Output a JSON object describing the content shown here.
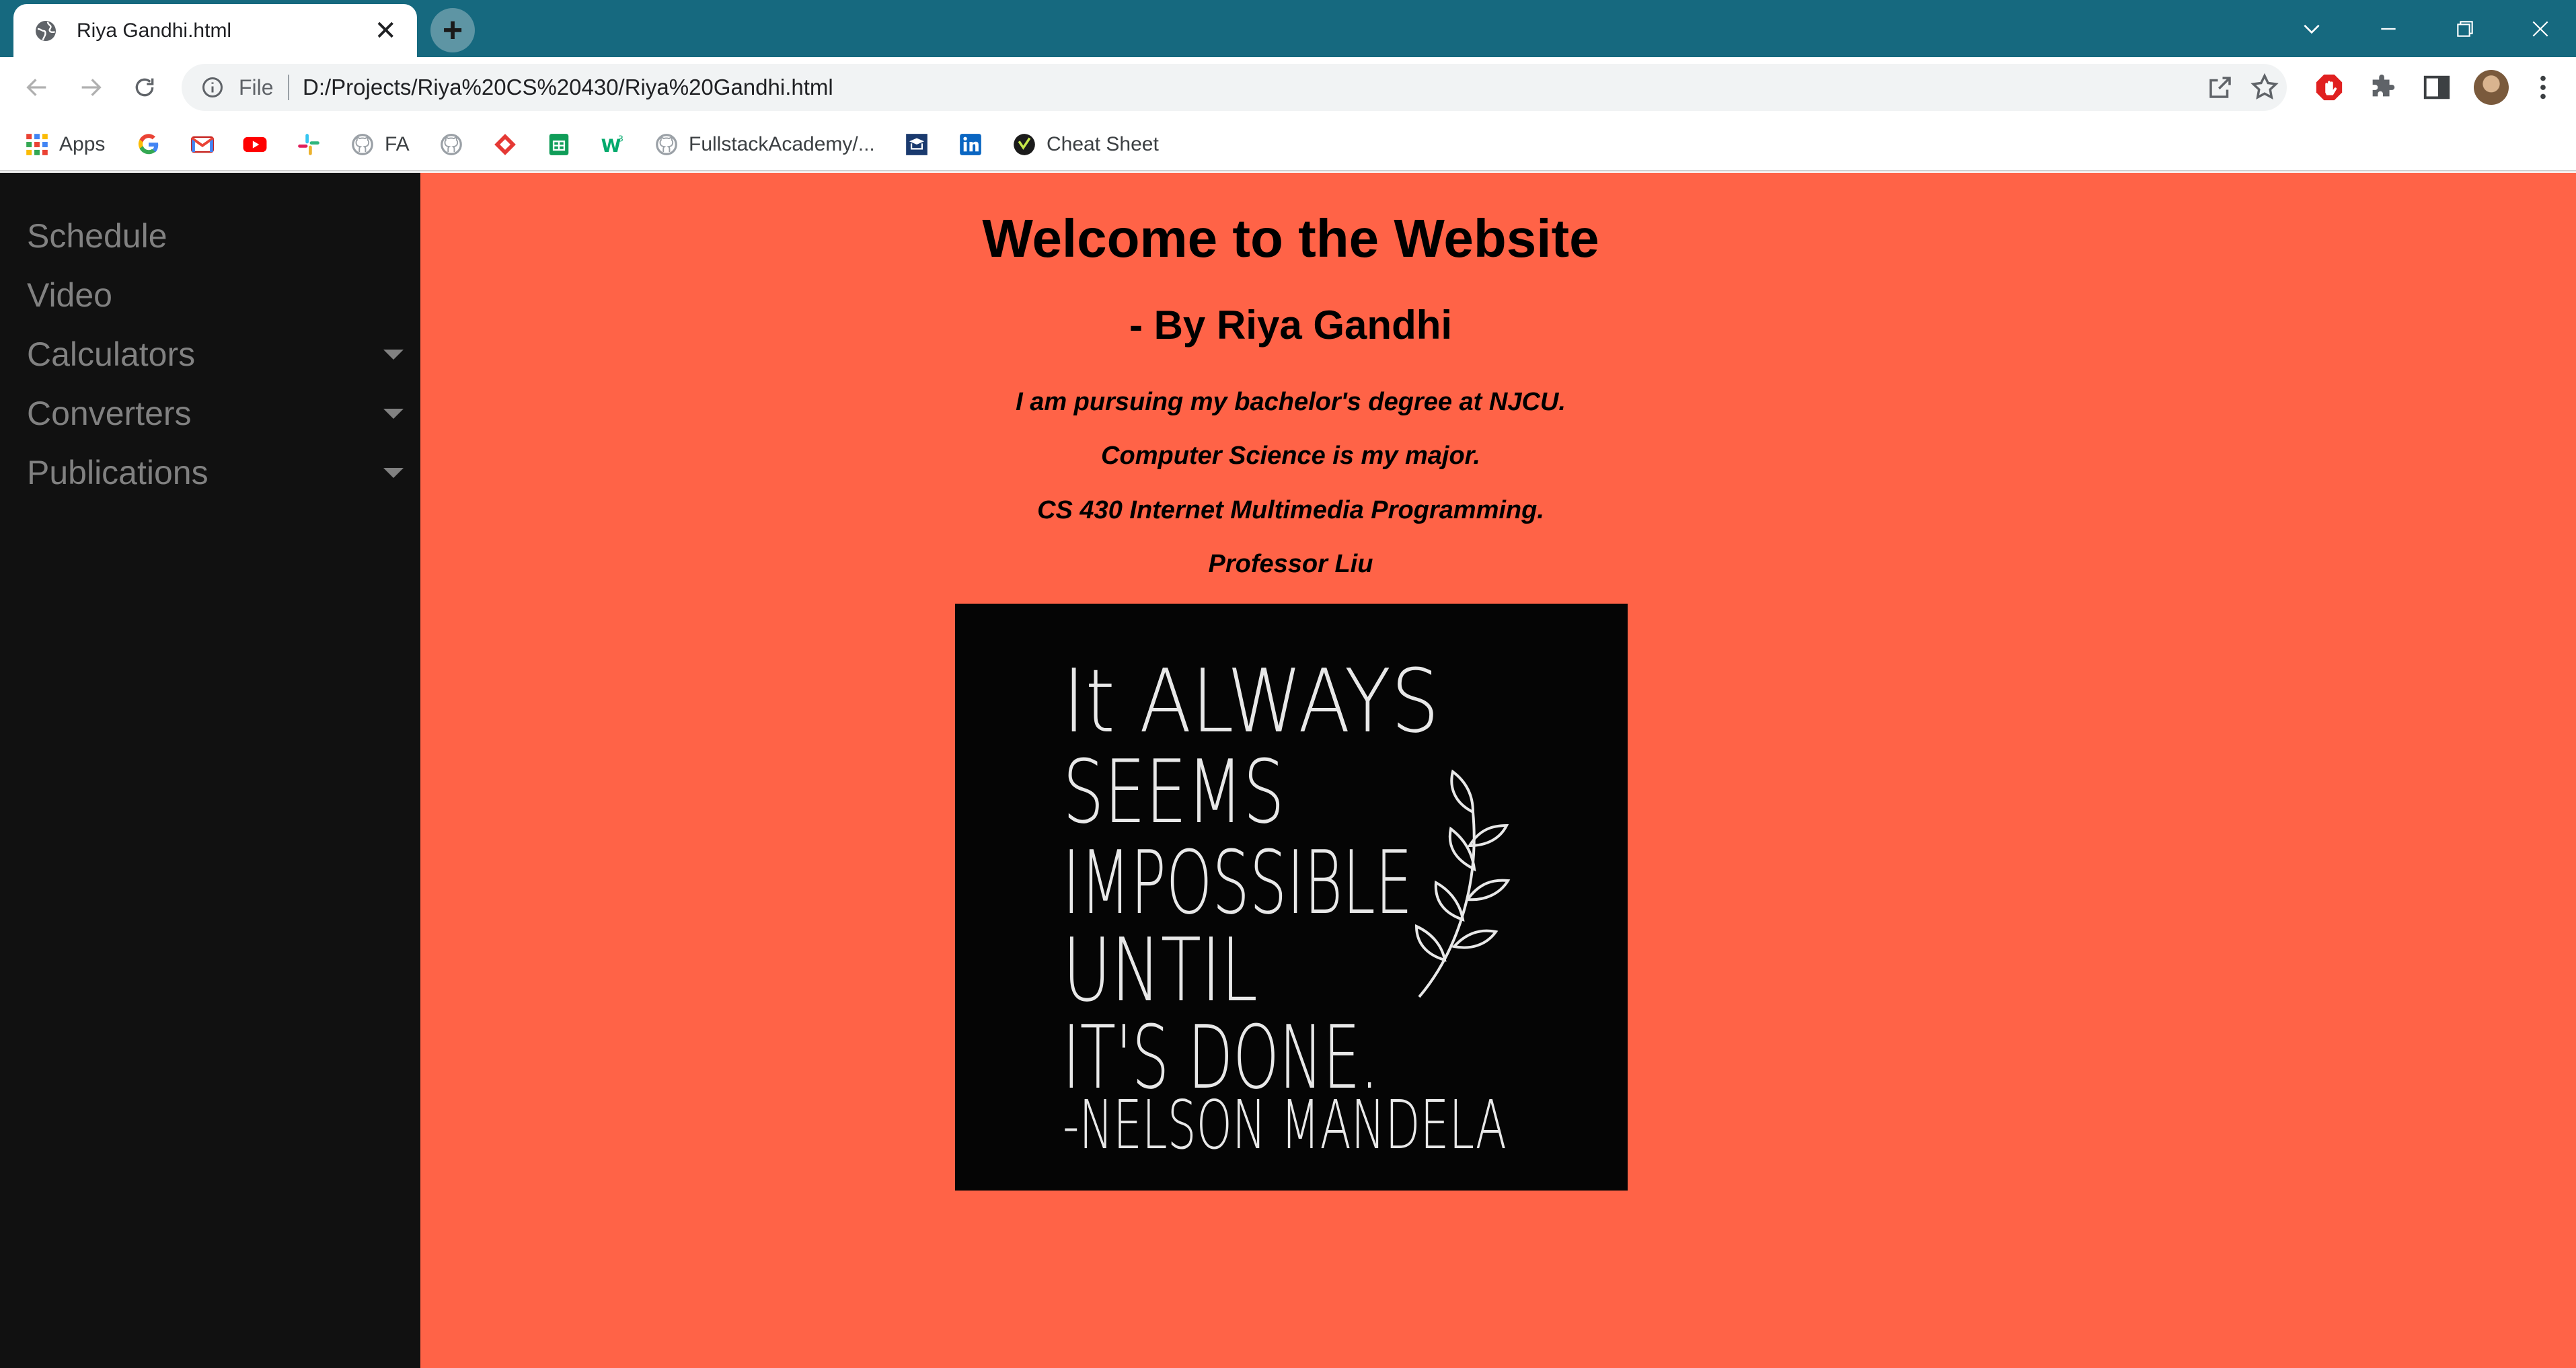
{
  "browser": {
    "tab_title": "Riya Gandhi.html",
    "address_scheme": "File",
    "address_url": "D:/Projects/Riya%20CS%20430/Riya%20Gandhi.html",
    "bookmarks": [
      {
        "label": "Apps",
        "icon": "apps-grid-icon"
      },
      {
        "label": "",
        "icon": "google-icon"
      },
      {
        "label": "",
        "icon": "gmail-icon"
      },
      {
        "label": "",
        "icon": "youtube-icon"
      },
      {
        "label": "",
        "icon": "slack-icon"
      },
      {
        "label": "FA",
        "icon": "github-icon"
      },
      {
        "label": "",
        "icon": "github-icon"
      },
      {
        "label": "",
        "icon": "diamond-icon"
      },
      {
        "label": "",
        "icon": "sheets-icon"
      },
      {
        "label": "",
        "icon": "w3schools-icon"
      },
      {
        "label": "FullstackAcademy/...",
        "icon": "github-icon"
      },
      {
        "label": "",
        "icon": "school-icon"
      },
      {
        "label": "",
        "icon": "linkedin-icon"
      },
      {
        "label": "Cheat Sheet",
        "icon": "cheat-sheet-icon"
      }
    ]
  },
  "sidebar": {
    "items": [
      {
        "label": "Schedule",
        "has_dropdown": false
      },
      {
        "label": "Video",
        "has_dropdown": false
      },
      {
        "label": "Calculators",
        "has_dropdown": true
      },
      {
        "label": "Converters",
        "has_dropdown": true
      },
      {
        "label": "Publications",
        "has_dropdown": true
      }
    ]
  },
  "main": {
    "heading": "Welcome to the Website",
    "subheading": "- By Riya Gandhi",
    "paragraphs": [
      "I am pursuing my bachelor's degree at NJCU.",
      "Computer Science is my major.",
      "CS 430 Internet Multimedia Programming.",
      "Professor Liu"
    ],
    "image_quote_lines": [
      "It ALWAYS",
      "SEEMS",
      "IMPOSSIBLE",
      "UNTIL",
      "IT'S DONE.",
      "-NELSON MANDELA"
    ]
  },
  "colors": {
    "page_background": "#ff6347",
    "sidebar_background": "#111111",
    "sidebar_text": "#818181",
    "tabstrip": "#16697f"
  }
}
